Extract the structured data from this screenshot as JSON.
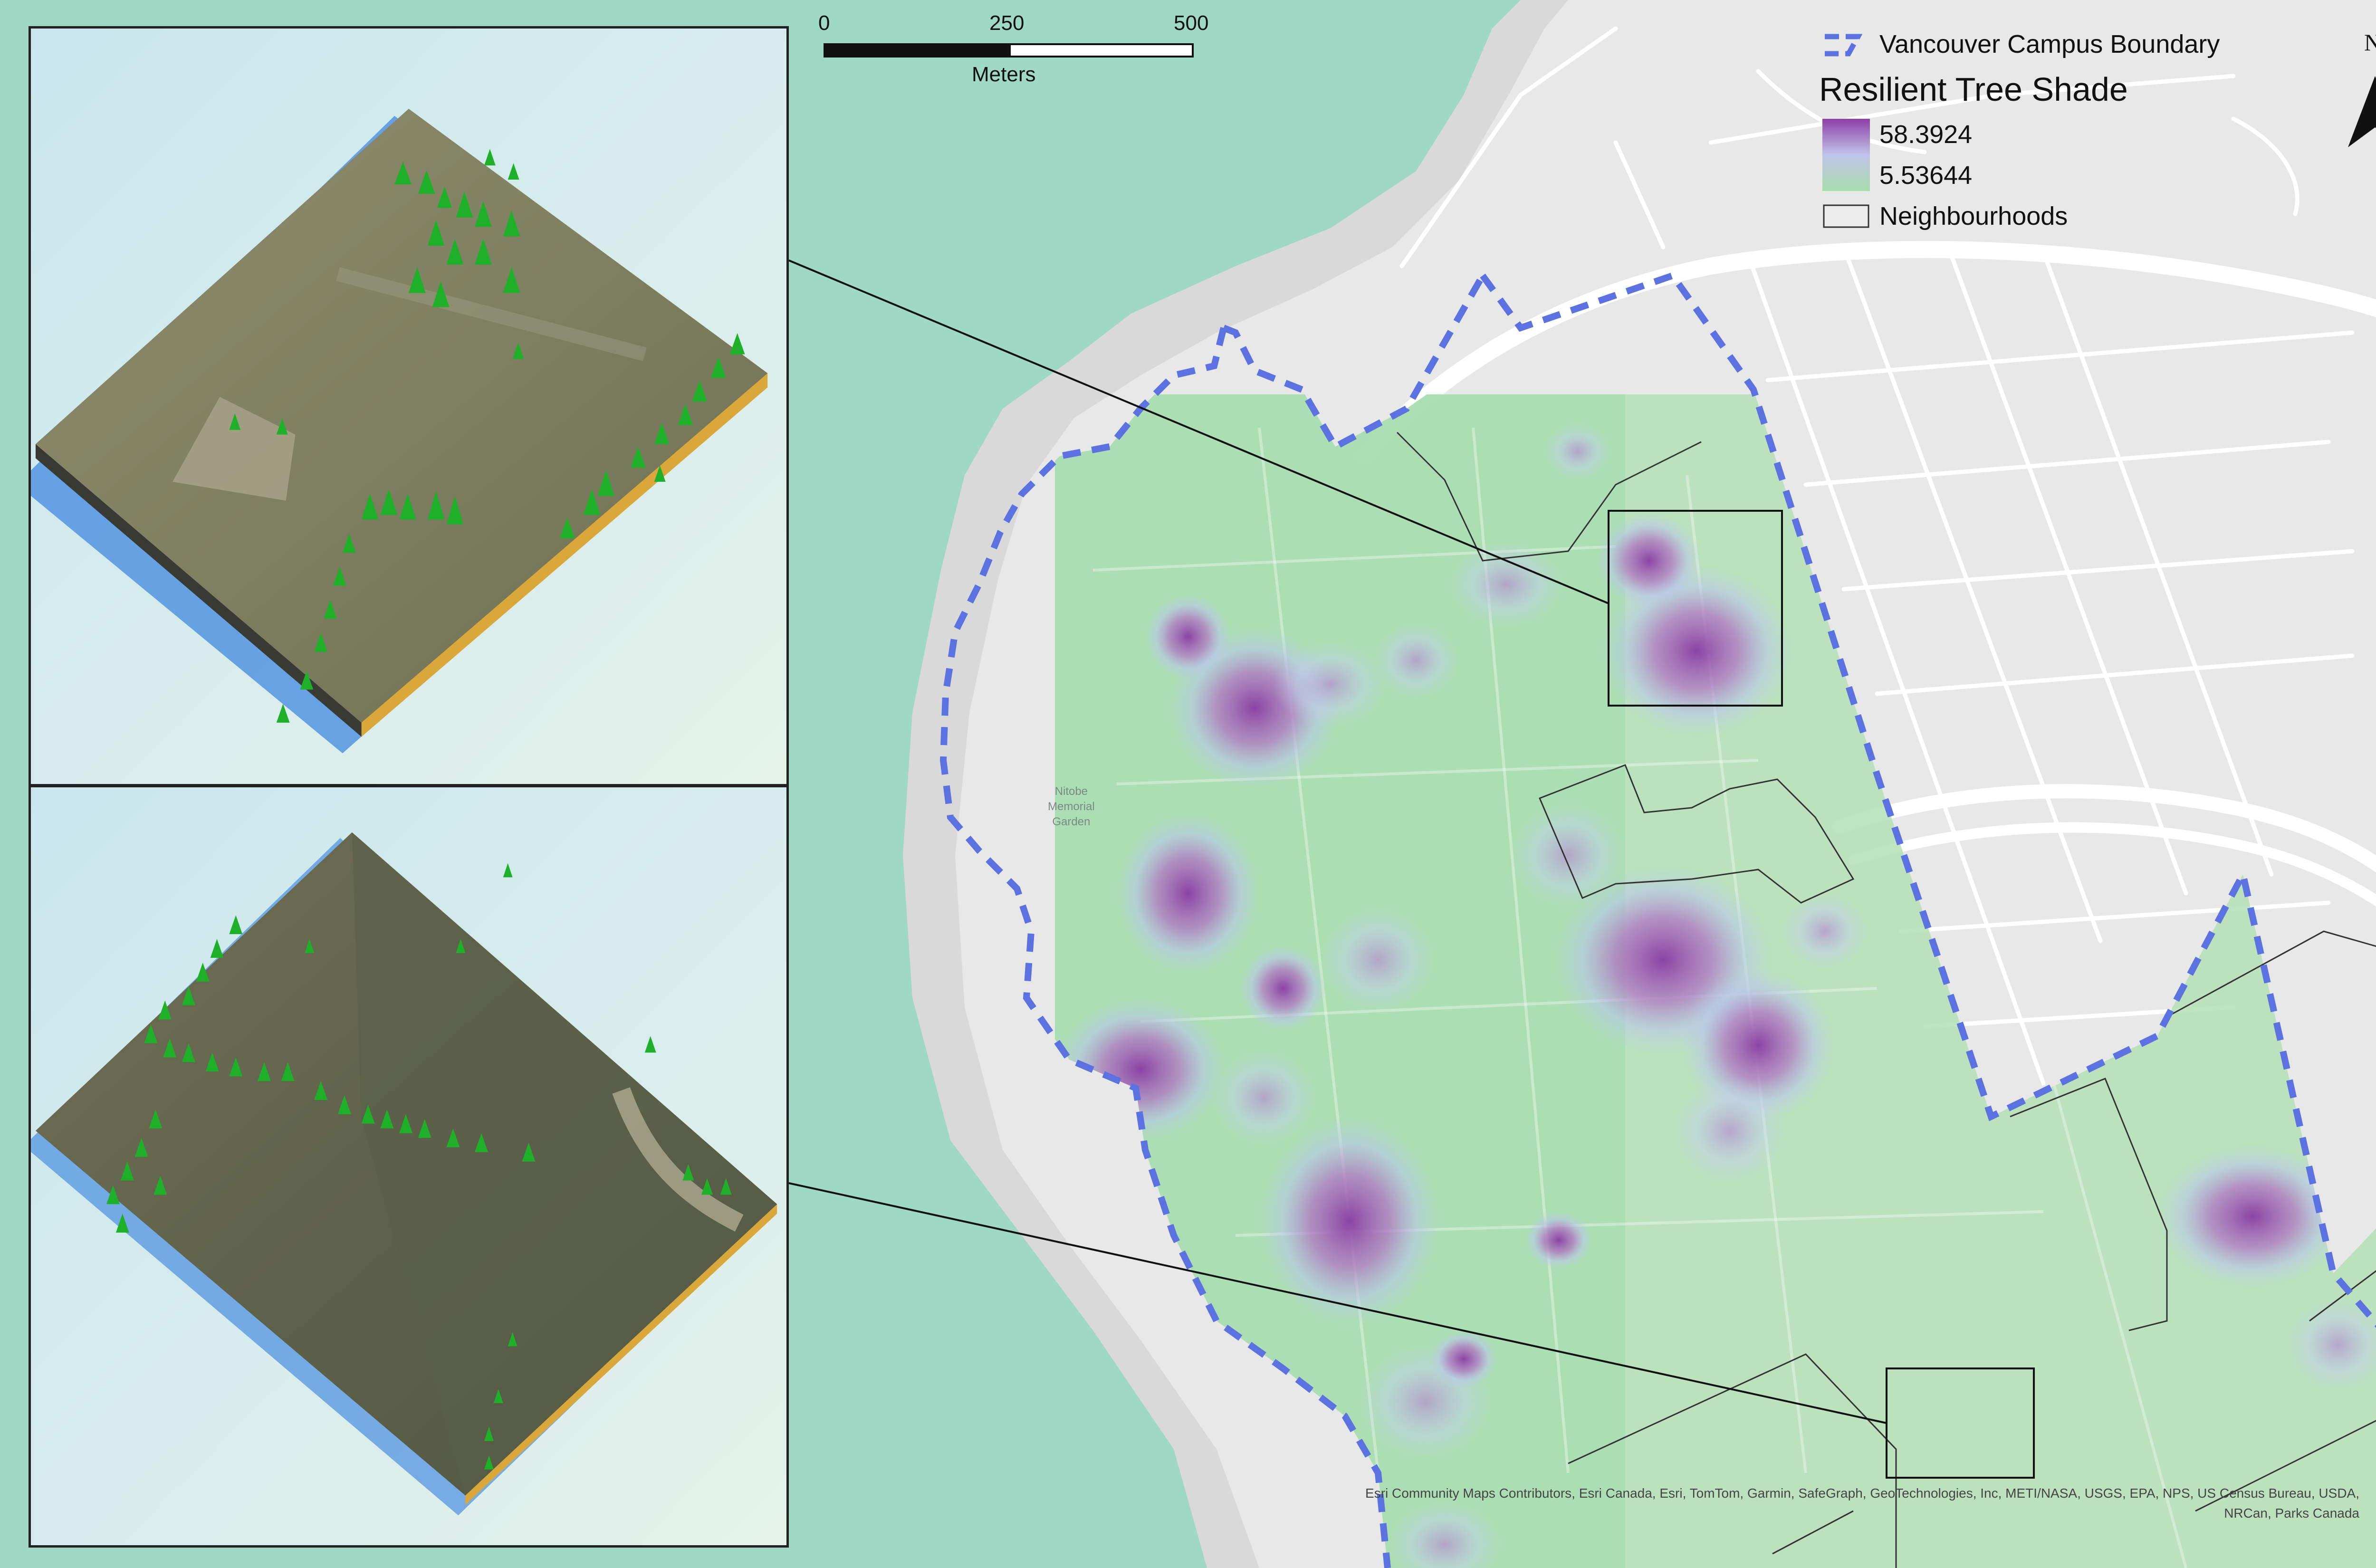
{
  "scale_bar": {
    "ticks": [
      "0",
      "250",
      "500"
    ],
    "units": "Meters"
  },
  "north_arrow": {
    "label": "N",
    "icon": "north-arrow-icon"
  },
  "legend": {
    "boundary_label": "Vancouver Campus Boundary",
    "title": "Resilient Tree Shade",
    "high_value": "58.3924",
    "low_value": "5.53644",
    "neighbourhoods_label": "Neighbourhoods"
  },
  "map_labels": {
    "garden_line1": "Nitobe",
    "garden_line2": "Memorial",
    "garden_line3": "Garden"
  },
  "attribution": {
    "line1": "Esri Community Maps Contributors, Esri Canada, Esri, TomTom, Garmin, SafeGraph, GeoTechnologies, Inc, METI/NASA, USGS, EPA, NPS, US Census Bureau, USDA,",
    "line2": "NRCan, Parks Canada"
  },
  "colors": {
    "water": "#9fd8c5",
    "land": "#e6e6e6",
    "shade_high": "#8e3fa6",
    "shade_low": "#a7dcac",
    "boundary": "#5b72e0"
  }
}
